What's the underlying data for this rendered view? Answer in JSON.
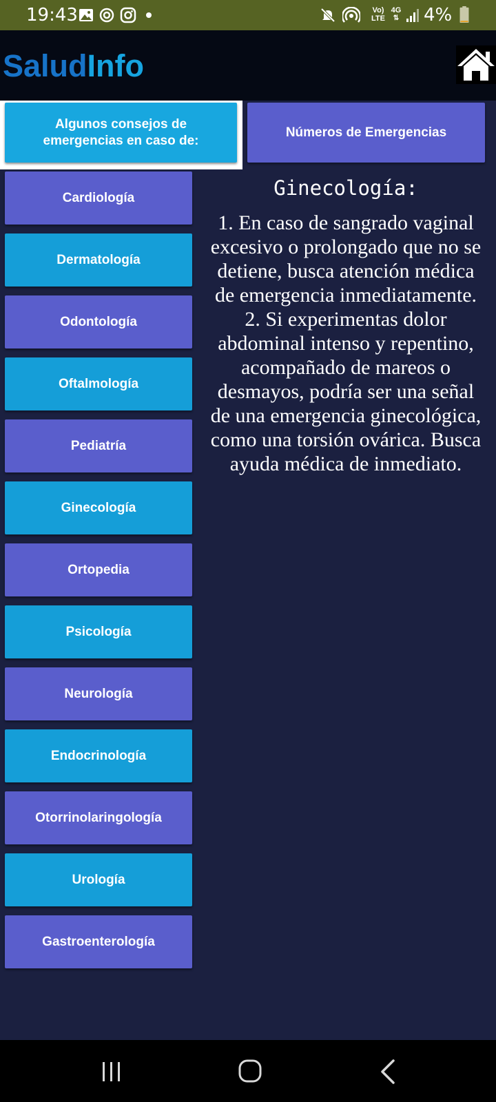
{
  "status_bar": {
    "time": "19:43",
    "battery": "4%",
    "network_badge_top": "Vo)",
    "network_badge_bottom": "LTE",
    "network_type": "4G"
  },
  "header": {
    "title_part1": "Salud",
    "title_part2": "Info"
  },
  "top_buttons": {
    "consejos_label": "Algunos consejos de emergencias en caso de:",
    "emergencias_label": "Números de Emergencias"
  },
  "specialties": [
    "Cardiología",
    "Dermatología",
    "Odontología",
    "Oftalmología",
    "Pediatría",
    "Ginecología",
    "Ortopedia",
    "Psicología",
    "Neurología",
    "Endocrinología",
    "Otorrinolaringología",
    "Urología",
    "Gastroenterología"
  ],
  "content": {
    "title": "Ginecología:",
    "text": "1. En caso de sangrado vaginal excesivo o prolongado que no se detiene, busca atención médica de emergencia inmediatamente. 2. Si experimentas dolor abdominal intenso y repentino, acompañado de mareos o desmayos, podría ser una señal de una emergencia ginecológica, como una torsión ovárica. Busca ayuda médica de inmediato."
  },
  "colors": {
    "status_bar": "#566323",
    "header_bg": "#050914",
    "page_bg": "#1b2040",
    "button_purple": "#5a5ecc",
    "button_cyan": "#159ed8",
    "title_dark_blue": "#1773c8",
    "title_light_blue": "#16a4e0"
  },
  "icons": {
    "status_left": [
      "gallery-icon",
      "sync-icon",
      "instagram-icon",
      "dot-icon"
    ],
    "status_right": [
      "mute-icon",
      "hotspot-icon",
      "volte-icon",
      "4g-icon",
      "signal-icon",
      "battery-icon"
    ],
    "header": "home-icon",
    "nav": [
      "recent-apps-icon",
      "home-circle-icon",
      "back-icon"
    ]
  }
}
